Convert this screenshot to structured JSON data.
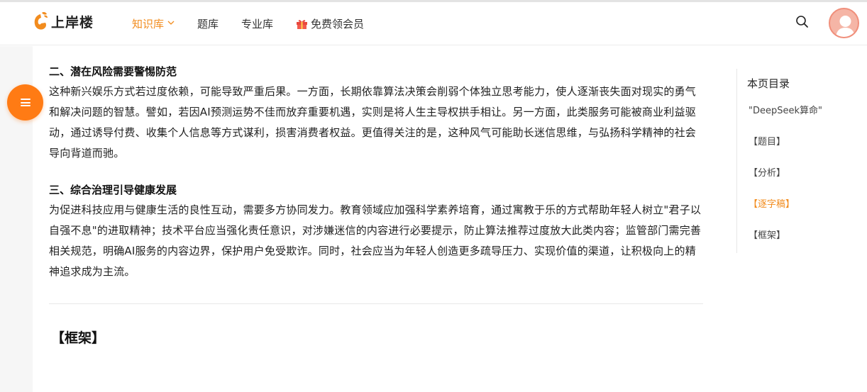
{
  "header": {
    "logo_text": "上岸楼",
    "nav": [
      {
        "label": "知识库",
        "active": true,
        "has_dropdown": true
      },
      {
        "label": "题库",
        "active": false
      },
      {
        "label": "专业库",
        "active": false
      },
      {
        "label": "免费领会员",
        "active": false,
        "icon": "gift-icon"
      }
    ]
  },
  "article": {
    "section2_title": "二、潜在风险需要警惕防范",
    "section2_body": "这种新兴娱乐方式若过度依赖，可能导致严重后果。一方面，长期依靠算法决策会削弱个体独立思考能力，使人逐渐丧失面对现实的勇气和解决问题的智慧。譬如，若因AI预测运势不佳而放弃重要机遇，实则是将人生主导权拱手相让。另一方面，此类服务可能被商业利益驱动，通过诱导付费、收集个人信息等方式谋利，损害消费者权益。更值得关注的是，这种风气可能助长迷信思维，与弘扬科学精神的社会导向背道而驰。",
    "section3_title": "三、综合治理引导健康发展",
    "section3_body": "为促进科技应用与健康生活的良性互动，需要多方协同发力。教育领域应加强科学素养培育，通过寓教于乐的方式帮助年轻人树立\"君子以自强不息\"的进取精神；技术平台应当强化责任意识，对涉嫌迷信的内容进行必要提示，防止算法推荐过度放大此类内容；监管部门需完善相关规范，明确AI服务的内容边界，保护用户免受欺诈。同时，社会应当为年轻人创造更多疏导压力、实现价值的渠道，让积极向上的精神追求成为主流。",
    "framework_heading": "【框架】"
  },
  "toc": {
    "title": "本页目录",
    "items": [
      {
        "label": "\"DeepSeek算命\"",
        "active": false
      },
      {
        "label": "【题目】",
        "active": false
      },
      {
        "label": "【分析】",
        "active": false
      },
      {
        "label": "【逐字稿】",
        "active": true
      },
      {
        "label": "【框架】",
        "active": false
      }
    ]
  },
  "colors": {
    "accent": "#f28c1e",
    "fab": "#ff7b14",
    "avatar": "#f5b5a6"
  }
}
